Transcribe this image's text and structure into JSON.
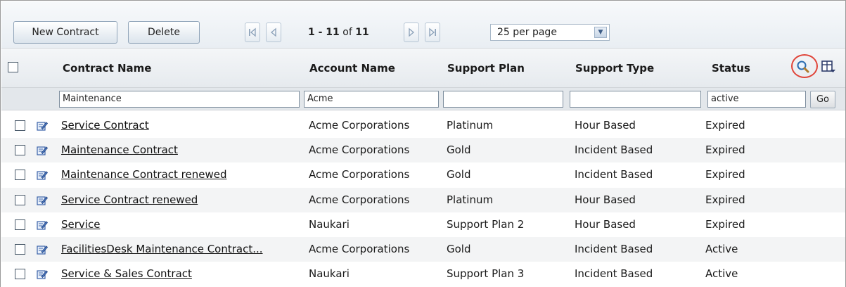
{
  "toolbar": {
    "new_contract_label": "New Contract",
    "delete_label": "Delete",
    "pager_range": "1 - 11",
    "pager_of": "of",
    "pager_total": "11",
    "per_page": "25 per page"
  },
  "columns": [
    "Contract Name",
    "Account Name",
    "Support Plan",
    "Support Type",
    "Status"
  ],
  "filters": {
    "contract_name": "Maintenance",
    "account_name": "Acme",
    "support_plan": "",
    "support_type": "",
    "status": "active",
    "go_label": "Go"
  },
  "rows": [
    {
      "name": "Service Contract",
      "account": "Acme Corporations",
      "plan": "Platinum",
      "type": "Hour Based",
      "status": "Expired"
    },
    {
      "name": "Maintenance Contract",
      "account": "Acme Corporations",
      "plan": "Gold",
      "type": "Incident Based",
      "status": "Expired"
    },
    {
      "name": "Maintenance Contract renewed",
      "account": "Acme Corporations",
      "plan": "Gold",
      "type": "Incident Based",
      "status": "Expired"
    },
    {
      "name": "Service Contract renewed",
      "account": "Acme Corporations",
      "plan": "Platinum",
      "type": "Hour Based",
      "status": "Expired"
    },
    {
      "name": "Service",
      "account": "Naukari",
      "plan": "Support Plan 2",
      "type": "Hour Based",
      "status": "Expired"
    },
    {
      "name": "FacilitiesDesk Maintenance Contract...",
      "account": "Acme Corporations",
      "plan": "Gold",
      "type": "Incident Based",
      "status": "Active"
    },
    {
      "name": "Service & Sales Contract",
      "account": "Naukari",
      "plan": "Support Plan 3",
      "type": "Incident Based",
      "status": "Active"
    }
  ],
  "icons": {
    "first_page": "first-page-icon",
    "prev_page": "prev-page-icon",
    "next_page": "next-page-icon",
    "last_page": "last-page-icon",
    "search": "search-icon",
    "column_chooser": "column-chooser-icon",
    "edit": "edit-icon"
  },
  "colors": {
    "highlight_circle": "#e0453a",
    "header_bg": "#e6eaee",
    "filter_bg": "#e3e7eb"
  }
}
